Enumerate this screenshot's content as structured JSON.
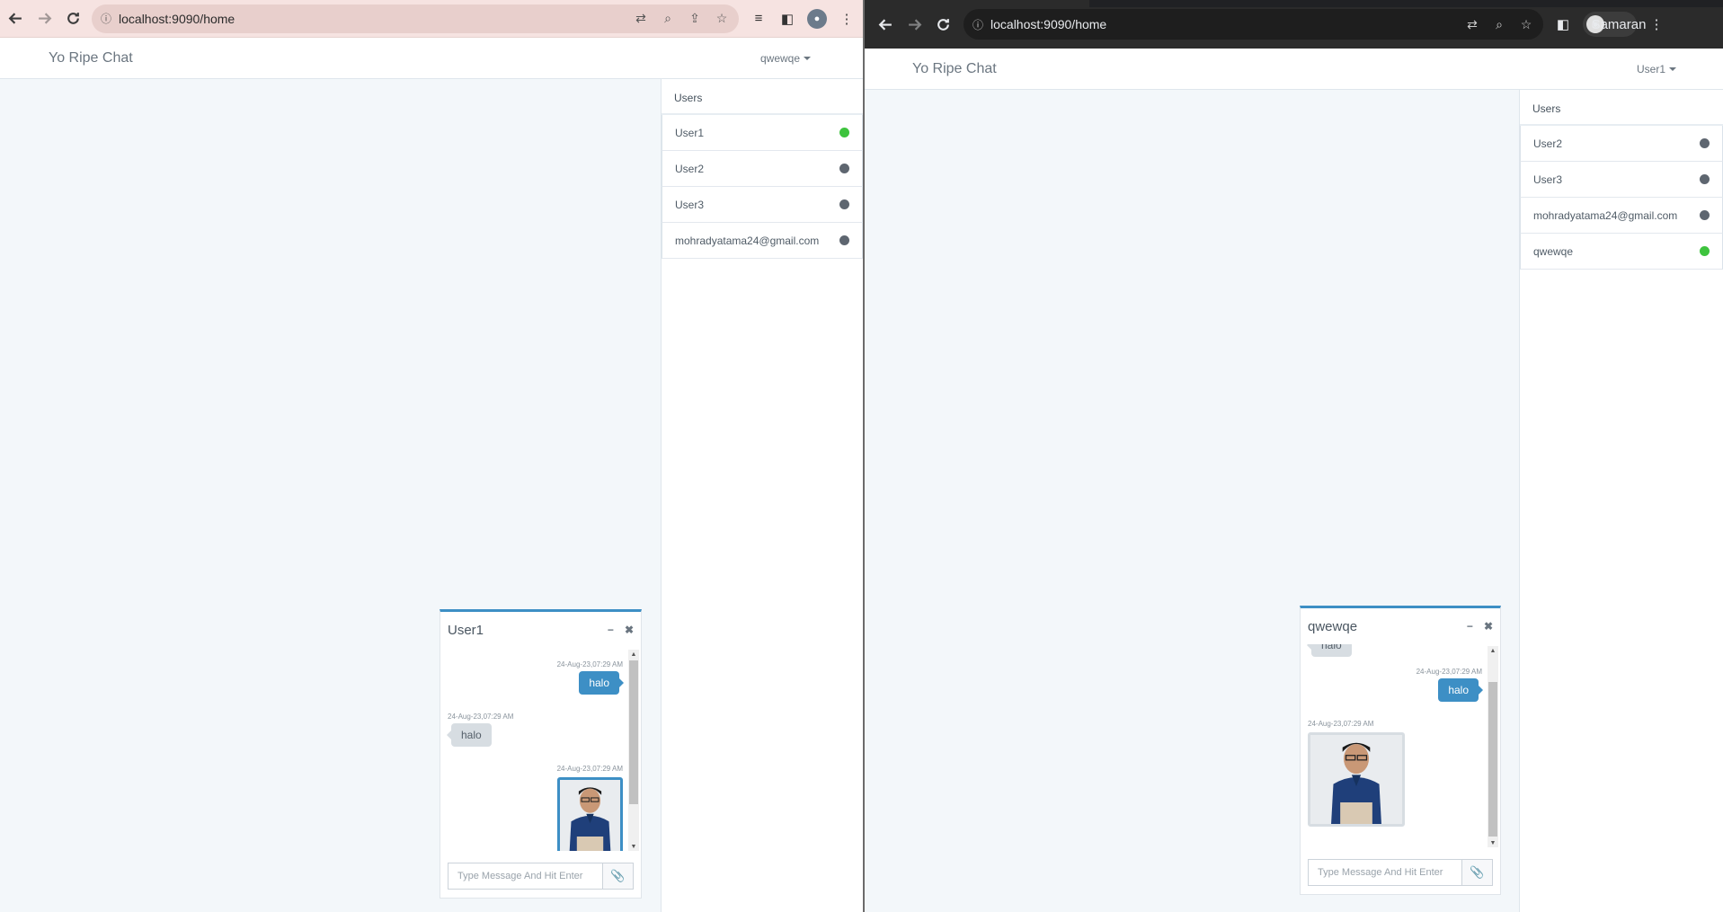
{
  "left": {
    "browser": {
      "url": "localhost:9090/home"
    },
    "app": {
      "brand": "Yo Ripe Chat",
      "current_user": "qwewqe"
    },
    "sidebar": {
      "title": "Users",
      "users": [
        {
          "name": "User1",
          "status": "online"
        },
        {
          "name": "User2",
          "status": "offline"
        },
        {
          "name": "User3",
          "status": "offline"
        },
        {
          "name": "mohradyatama24@gmail.com",
          "status": "offline"
        }
      ]
    },
    "chat": {
      "title": "User1",
      "minimize_label": "−",
      "close_label": "✖",
      "messages": [
        {
          "time": "24-Aug-23,07:29 AM",
          "text": "halo",
          "direction": "out"
        },
        {
          "time": "24-Aug-23,07:29 AM",
          "text": "halo",
          "direction": "in"
        },
        {
          "time": "24-Aug-23,07:29 AM",
          "image": "person-photo",
          "direction": "out"
        }
      ],
      "input_placeholder": "Type Message And Hit Enter"
    }
  },
  "right": {
    "browser": {
      "url": "localhost:9090/home",
      "profile_name": "Samaran"
    },
    "app": {
      "brand": "Yo Ripe Chat",
      "current_user": "User1"
    },
    "sidebar": {
      "title": "Users",
      "users": [
        {
          "name": "User2",
          "status": "offline"
        },
        {
          "name": "User3",
          "status": "offline"
        },
        {
          "name": "mohradyatama24@gmail.com",
          "status": "offline"
        },
        {
          "name": "qwewqe",
          "status": "online"
        }
      ]
    },
    "chat": {
      "title": "qwewqe",
      "minimize_label": "−",
      "close_label": "✖",
      "messages": [
        {
          "text": "halo",
          "direction": "in"
        },
        {
          "time": "24-Aug-23,07:29 AM",
          "text": "halo",
          "direction": "out"
        },
        {
          "time": "24-Aug-23,07:29 AM",
          "image": "person-photo",
          "direction": "in"
        }
      ],
      "input_placeholder": "Type Message And Hit Enter"
    }
  },
  "colors": {
    "accent": "#3d8fc5",
    "online": "#3ec33e",
    "offline": "#5e6670",
    "page_bg": "#f3f7fa"
  }
}
